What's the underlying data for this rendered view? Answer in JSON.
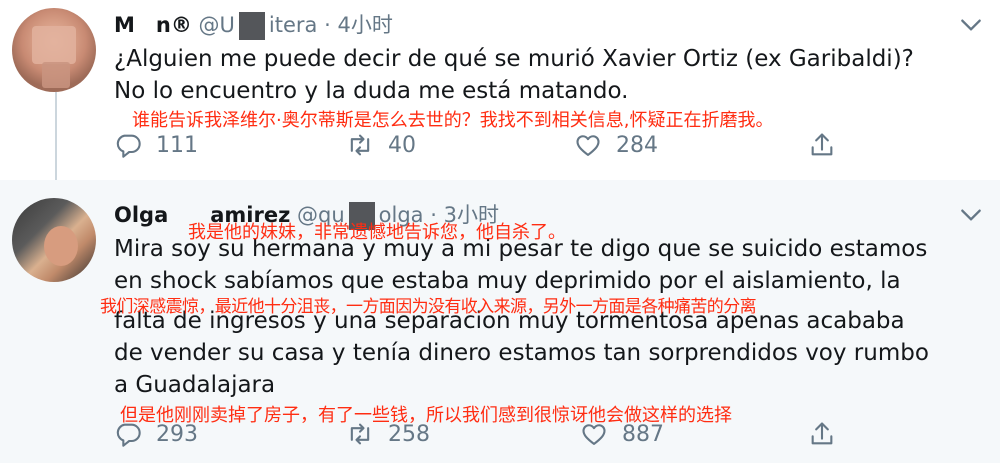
{
  "tweets": [
    {
      "name": "M n®",
      "handle_start": "@U",
      "handle_end": "itera",
      "dot": "·",
      "time": "4小时",
      "lines": [
        "¿Alguien me puede decir de qué se murió Xavier Ortiz (ex Garibaldi)?",
        "No lo encuentro y la duda me está matando."
      ],
      "overlay_lines": [
        "谁能告诉我泽维尔·奥尔蒂斯是怎么去世的？我找不到相关信息,怀疑正在折磨我。"
      ],
      "stats": {
        "replies": "111",
        "retweets": "40",
        "likes": "284"
      }
    },
    {
      "name": "Olga  amirez",
      "handle_start": "@qu",
      "handle_end": "olga",
      "dot": "·",
      "time": "3小时",
      "lines": [
        "Mira soy su hermana y muy a mi pesar te digo que se suicido estamos",
        "en shock sabíamos que estaba muy deprimido por el aislamiento, la",
        "falta de ingresos y una separacion muy tormentosa apenas acababa",
        "de vender su casa y tenía dinero estamos tan sorprendidos voy rumbo",
        "a Guadalajara"
      ],
      "overlay_lines": [
        "我是他的妹妹，非常遗憾地告诉您，他自杀了。",
        "我们深感震惊，最近他十分沮丧，一方面因为没有收入来源，另外一方面是各种痛苦的分离",
        "但是他刚刚卖掉了房子，有了一些钱，所以我们感到很惊讶他会做这样的选择"
      ],
      "stats": {
        "replies": "293",
        "retweets": "258",
        "likes": "887"
      }
    }
  ],
  "colors": {
    "overlay": "#ff2d12",
    "meta": "#657786",
    "text": "#14171a"
  },
  "icons": [
    "chevron-down-icon",
    "reply-icon",
    "retweet-icon",
    "like-icon",
    "share-icon"
  ]
}
